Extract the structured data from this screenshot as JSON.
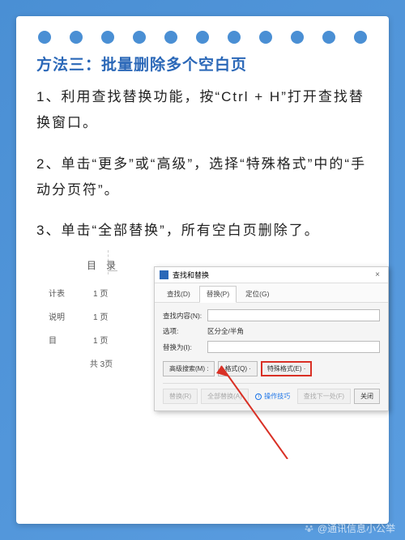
{
  "title": "方法三：批量删除多个空白页",
  "steps": {
    "s1": "1、利用查找替换功能，按“Ctrl + H”打开查找替换窗口。",
    "s2": "2、单击“更多”或“高级”，选择“特殊格式”中的“手动分页符”。",
    "s3": "3、单击“全部替换”，所有空白页删除了。"
  },
  "doc": {
    "heading": "目录",
    "rows": [
      {
        "label": "计表",
        "val": "1 页"
      },
      {
        "label": "说明",
        "val": "1 页"
      },
      {
        "label": "目",
        "val": "1 页"
      }
    ],
    "total": "共 3页"
  },
  "dialog": {
    "title": "查找和替换",
    "tabs": {
      "find": "查找(D)",
      "replace": "替换(P)",
      "goto": "定位(G)"
    },
    "findLabel": "查找内容(N):",
    "optionsLabel": "选项:",
    "optionsValue": "区分全/半角",
    "replaceLabel": "替换为(I):",
    "buttons": {
      "advancedSearch": "高级搜索(M) :",
      "format": "格式(Q) ·",
      "special": "特殊格式(E) ·",
      "replaceOne": "替换(R)",
      "replaceAll": "全部替换(A)",
      "findNext": "查找下一处(F)",
      "close": "关闭"
    },
    "tips": "操作技巧"
  },
  "watermark": "@通讯信息小公举"
}
